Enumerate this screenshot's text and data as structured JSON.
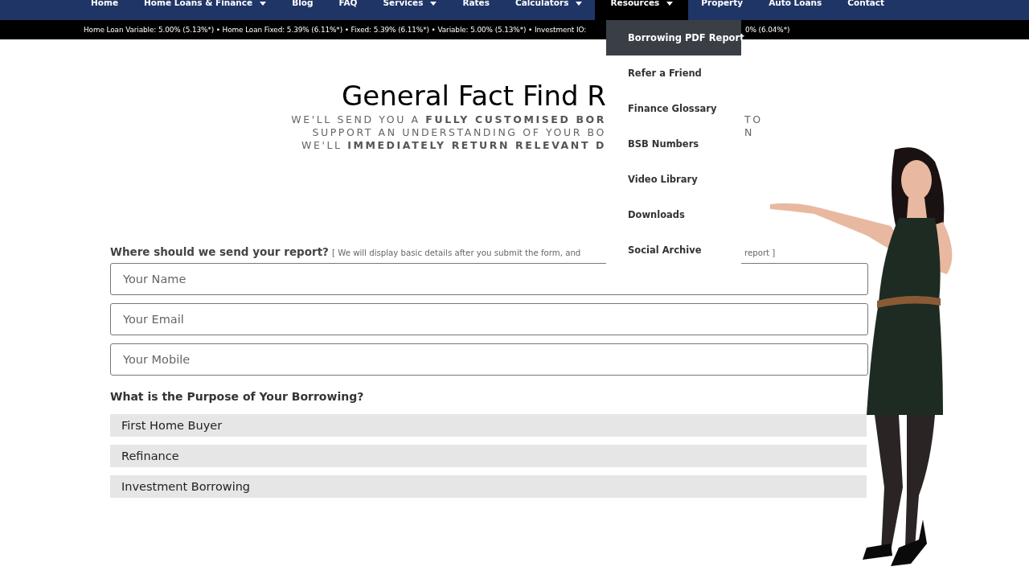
{
  "nav": {
    "items": [
      {
        "label": "Home",
        "caret": false,
        "selected": false
      },
      {
        "label": "Home Loans & Finance",
        "caret": true,
        "selected": false
      },
      {
        "label": "Blog",
        "caret": false,
        "selected": false
      },
      {
        "label": "FAQ",
        "caret": false,
        "selected": false
      },
      {
        "label": "Services",
        "caret": true,
        "selected": false
      },
      {
        "label": "Rates",
        "caret": false,
        "selected": false
      },
      {
        "label": "Calculators",
        "caret": true,
        "selected": false
      },
      {
        "label": "Resources",
        "caret": true,
        "selected": true
      },
      {
        "label": "Property",
        "caret": false,
        "selected": false
      },
      {
        "label": "Auto Loans",
        "caret": false,
        "selected": false
      },
      {
        "label": "Contact",
        "caret": false,
        "selected": false
      }
    ]
  },
  "ticker": {
    "left": "Home Loan Variable: 5.00% (5.13%*) • Home Loan Fixed: 5.39% (6.11%*) • Fixed: 5.39% (6.11%*) • Variable: 5.00% (5.13%*) • Investment IO:",
    "right": "0% (6.04%*)"
  },
  "dropdown": {
    "items": [
      {
        "label": "Borrowing PDF Report",
        "selected": true
      },
      {
        "label": "Refer a Friend",
        "selected": false
      },
      {
        "label": "Finance Glossary",
        "selected": false
      },
      {
        "label": "BSB Numbers",
        "selected": false
      },
      {
        "label": "Video Library",
        "selected": false
      },
      {
        "label": "Downloads",
        "selected": false
      },
      {
        "label": "Social Archive",
        "selected": false
      }
    ]
  },
  "heading": "General Fact Find R",
  "subtitle": [
    {
      "left": "WE'LL SEND YOU A **FULLY CUSTOMISED BOR**",
      "right": "TO"
    },
    {
      "left": "SUPPORT AN UNDERSTANDING OF YOUR BO",
      "right": "N"
    },
    {
      "left": "WE'LL **IMMEDIATELY RETURN RELEVANT D**"
    }
  ],
  "form": {
    "question": "Where should we send your report?",
    "note_left": "[ We will display basic details after you submit the form, and",
    "note_right": "report ]",
    "fields": [
      {
        "placeholder": "Your Name"
      },
      {
        "placeholder": "Your Email"
      },
      {
        "placeholder": "Your Mobile"
      }
    ],
    "purpose_label": "What is the Purpose of Your Borrowing?",
    "options": [
      "First Home Buyer",
      "Refinance",
      "Investment Borrowing"
    ]
  }
}
